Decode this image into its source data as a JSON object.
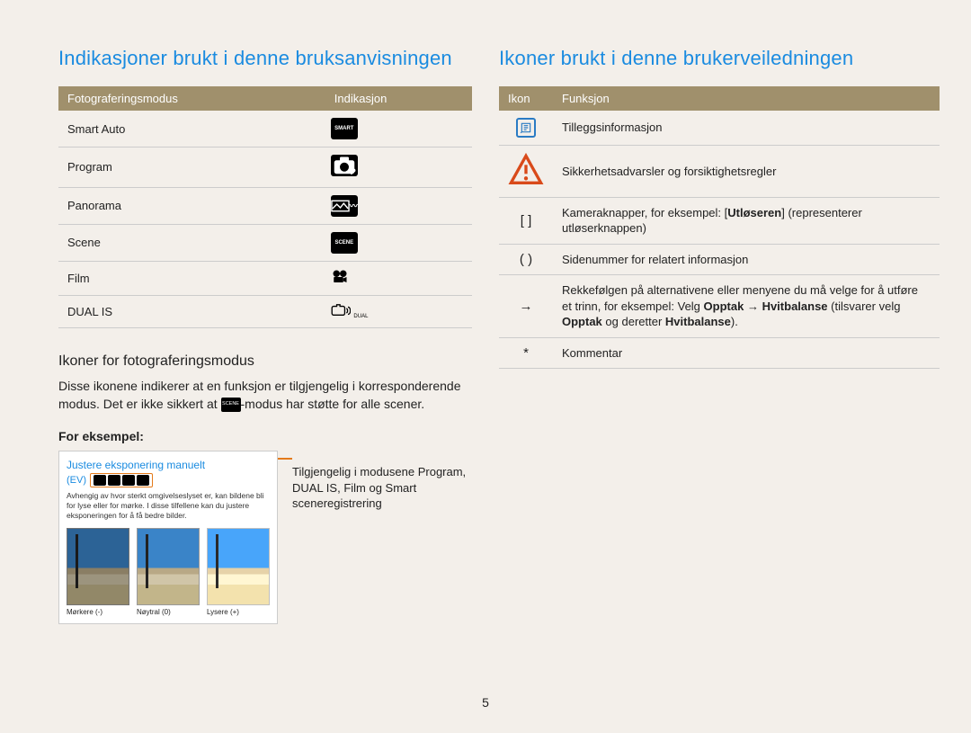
{
  "page_number": "5",
  "left": {
    "heading": "Indikasjoner brukt i denne bruksanvisningen",
    "table": {
      "headers": [
        "Fotograferingsmodus",
        "Indikasjon"
      ],
      "rows": [
        {
          "mode": "Smart Auto",
          "icon": "smart-auto-icon"
        },
        {
          "mode": "Program",
          "icon": "program-icon"
        },
        {
          "mode": "Panorama",
          "icon": "panorama-icon"
        },
        {
          "mode": "Scene",
          "icon": "scene-icon"
        },
        {
          "mode": "Film",
          "icon": "film-icon"
        },
        {
          "mode": "DUAL IS",
          "icon": "dual-is-icon"
        }
      ]
    },
    "subheading": "Ikoner for fotograferingsmodus",
    "intro_pre": "Disse ikonene indikerer at en funksjon er tilgjengelig i korresponderende modus. Det er ikke sikkert at ",
    "intro_post": "-modus har støtte for alle scener.",
    "for_example": "For eksempel:",
    "example": {
      "title": "Justere eksponering manuelt",
      "ev_label": "(EV)",
      "desc": "Avhengig av hvor sterkt omgivelseslyset er, kan bildene bli for lyse eller for mørke. I disse tilfellene kan du justere eksponeringen for å få bedre bilder.",
      "thumbs": [
        {
          "caption": "Mørkere (-)"
        },
        {
          "caption": "Nøytral (0)"
        },
        {
          "caption": "Lysere (+)"
        }
      ]
    },
    "callout": "Tilgjengelig i modusene Program, DUAL IS, Film og Smart sceneregistrering"
  },
  "right": {
    "heading": "Ikoner brukt i denne brukerveiledningen",
    "table": {
      "headers": [
        "Ikon",
        "Funksjon"
      ],
      "rows": [
        {
          "icon": "info-icon",
          "symbol": "",
          "desc_plain": "Tilleggsinformasjon"
        },
        {
          "icon": "warning-icon",
          "symbol": "",
          "desc_plain": "Sikkerhetsadvarsler og forsiktighetsregler"
        },
        {
          "icon": "brackets-icon",
          "symbol": "[  ]",
          "desc_pre": "Kameraknapper, for eksempel: [",
          "desc_bold": "Utløseren",
          "desc_post": "] (representerer utløserknappen)"
        },
        {
          "icon": "paren-icon",
          "symbol": "(  )",
          "desc_plain": "Sidenummer for relatert informasjon"
        },
        {
          "icon": "arrow-icon",
          "symbol": "→",
          "desc_pre": "Rekkefølgen på alternativene eller menyene du må velge for å utføre et trinn, for eksempel: Velg ",
          "desc_bold": "Opptak",
          "desc_mid": " → ",
          "desc_bold2": "Hvitbalanse",
          "desc_mid2": " (tilsvarer velg ",
          "desc_bold3": "Opptak",
          "desc_mid3": " og deretter ",
          "desc_bold4": "Hvitbalanse",
          "desc_end": ")."
        },
        {
          "icon": "asterisk-icon",
          "symbol": "*",
          "desc_plain": "Kommentar"
        }
      ]
    }
  }
}
